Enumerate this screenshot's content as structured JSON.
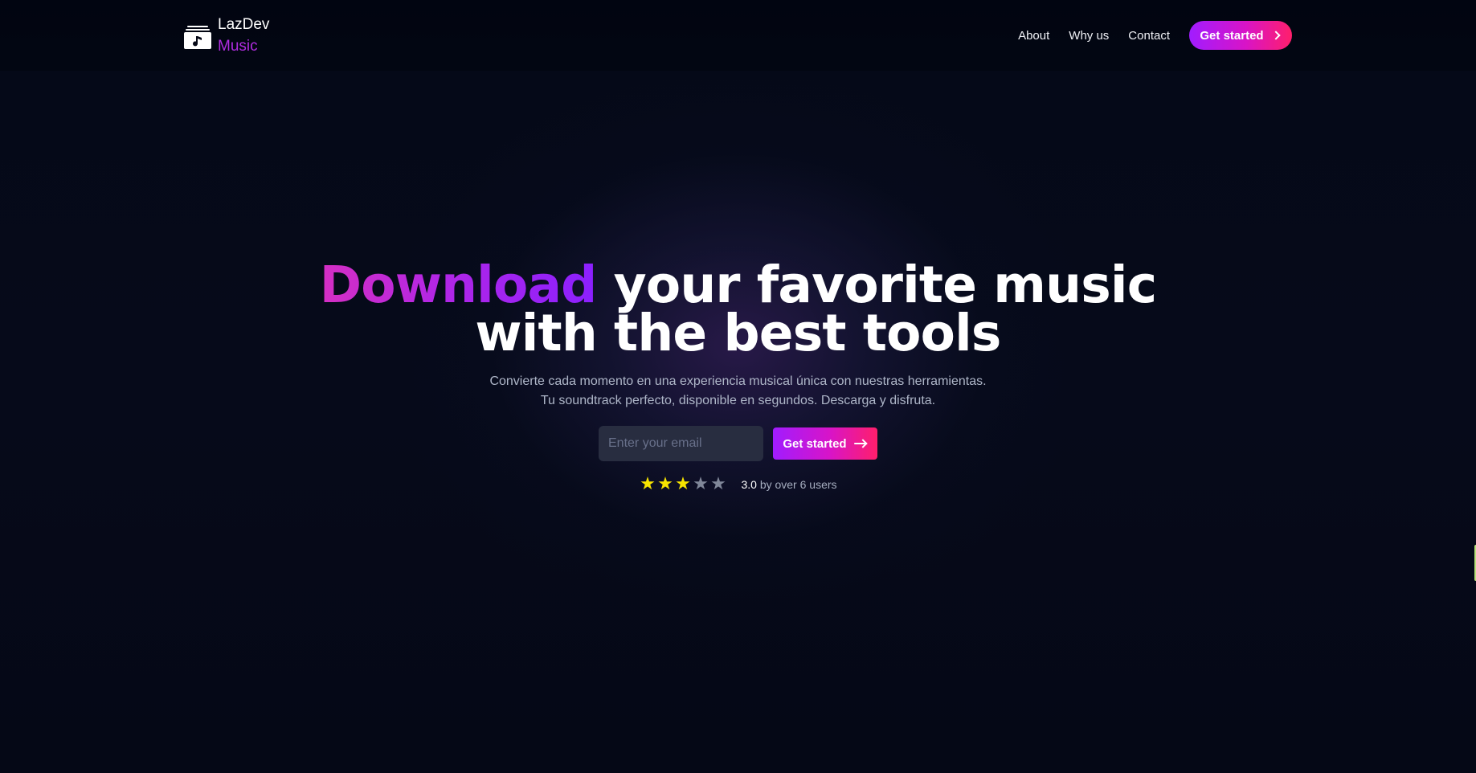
{
  "brand": {
    "primary": "LazDev",
    "secondary": "Music",
    "icon": "music-folder-icon"
  },
  "nav": {
    "links": [
      {
        "label": "About"
      },
      {
        "label": "Why us"
      },
      {
        "label": "Contact"
      }
    ],
    "cta_label": "Get started",
    "cta_icon": "chevron-right-icon"
  },
  "hero": {
    "headline_accent": "Download",
    "headline_rest_line1": "your favorite music",
    "headline_line2": "with the best tools",
    "subtitle": "Convierte cada momento en una experiencia musical única con nuestras herramientas. Tu soundtrack perfecto, disponible en segundos. Descarga y disfruta.",
    "email_placeholder": "Enter your email",
    "email_value": "",
    "button_label": "Get started",
    "button_icon": "arrow-right-icon"
  },
  "rating": {
    "score": 3.0,
    "score_label": "3.0",
    "caption": "by over 6 users",
    "max_stars": 5,
    "star_icon": "star-icon"
  },
  "colors": {
    "background": "#050816",
    "accent_purple": "#a11cff",
    "accent_magenta": "#d814c7",
    "accent_pink": "#ff1f6b",
    "star_filled": "#f7e400",
    "star_empty": "#808799",
    "input_background": "#282d40"
  }
}
